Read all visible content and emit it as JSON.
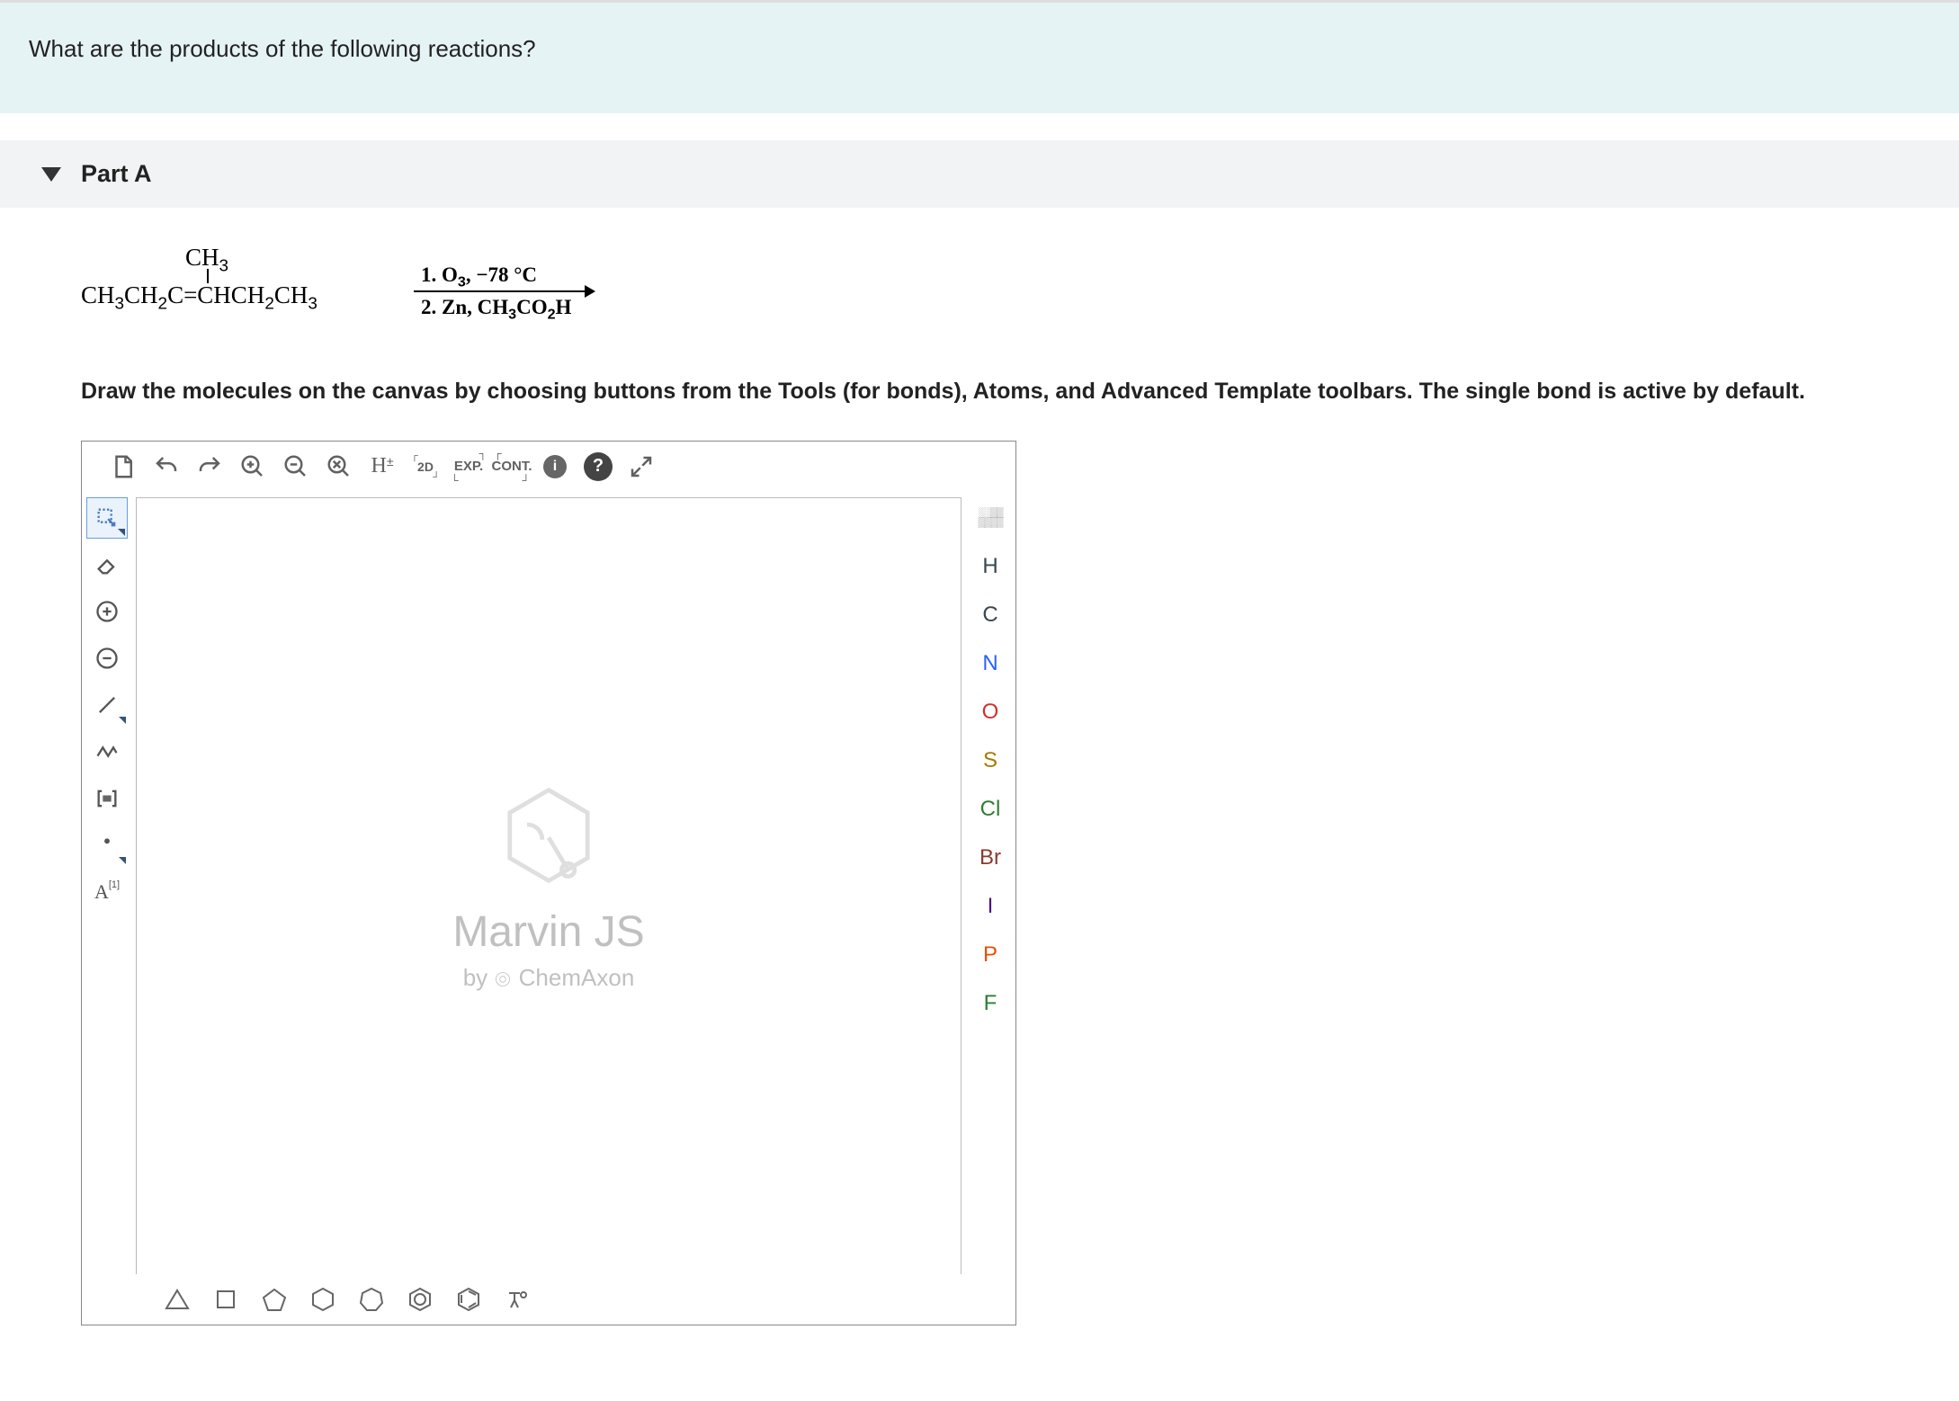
{
  "question": "What are the products of the following reactions?",
  "part_label": "Part A",
  "reaction": {
    "substituent": "CH₃",
    "formula": "CH₃CH₂C=CHCH₂CH₃",
    "cond1": "1. O₃, −78 °C",
    "cond2": "2. Zn, CH₃CO₂H"
  },
  "instruction": "Draw the molecules on the canvas by choosing buttons from the Tools (for bonds), Atoms, and Advanced Template toolbars. The single bond is active by default.",
  "top_tools": {
    "exp": "EXP.",
    "cont": "CONT.",
    "hpm": "H±",
    "twod": "2D"
  },
  "watermark": {
    "title": "Marvin JS",
    "subtitle_by": "by",
    "subtitle_brand": "ChemAxon"
  },
  "atoms": [
    "H",
    "C",
    "N",
    "O",
    "S",
    "Cl",
    "Br",
    "I",
    "P",
    "F"
  ],
  "left_tool_map": "A[1]"
}
